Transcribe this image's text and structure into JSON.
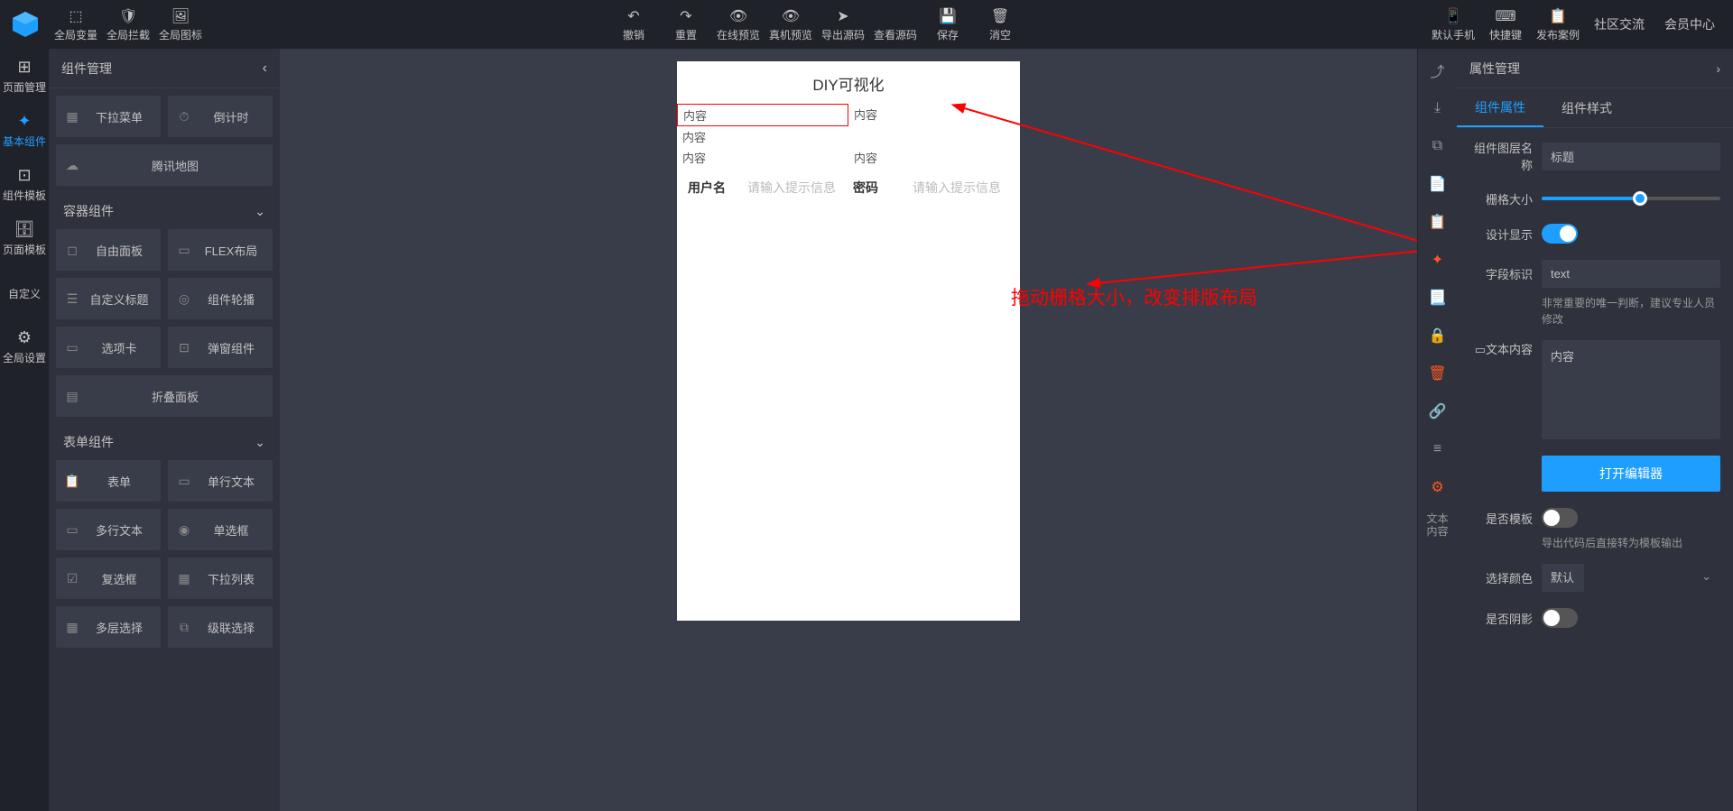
{
  "toolbar": {
    "left": [
      {
        "icon": "⬚",
        "label": "全局变量"
      },
      {
        "icon": "🛡",
        "label": "全局拦截"
      },
      {
        "icon": "🖼",
        "label": "全局图标"
      }
    ],
    "center": [
      {
        "icon": "↶",
        "label": "撤销"
      },
      {
        "icon": "↷",
        "label": "重置"
      },
      {
        "icon": "👁",
        "label": "在线预览"
      },
      {
        "icon": "👁",
        "label": "真机预览"
      },
      {
        "icon": "➤",
        "label": "导出源码"
      },
      {
        "icon": "</>",
        "label": "查看源码"
      },
      {
        "icon": "💾",
        "label": "保存"
      },
      {
        "icon": "🗑",
        "label": "消空"
      }
    ],
    "right": [
      {
        "icon": "📱",
        "label": "默认手机"
      },
      {
        "icon": "⌨",
        "label": "快捷键"
      },
      {
        "icon": "📋",
        "label": "发布案例"
      }
    ],
    "links": [
      "社区交流",
      "会员中心"
    ]
  },
  "left_nav": [
    {
      "icon": "⊞",
      "label": "页面管理",
      "active": false
    },
    {
      "icon": "✦",
      "label": "基本组件",
      "active": true
    },
    {
      "icon": "⊡",
      "label": "组件模板",
      "active": false
    },
    {
      "icon": "🗄",
      "label": "页面模板",
      "active": false
    },
    {
      "icon": "</>",
      "label": "自定义",
      "active": false
    },
    {
      "icon": "⚙",
      "label": "全局设置",
      "active": false
    }
  ],
  "comp_panel": {
    "title": "组件管理",
    "group0": [
      {
        "icon": "▦",
        "label": "下拉菜单"
      },
      {
        "icon": "⏱",
        "label": "倒计时"
      },
      {
        "icon": "☁",
        "label": "腾讯地图"
      }
    ],
    "group1_title": "容器组件",
    "group1": [
      {
        "icon": "◻",
        "label": "自由面板"
      },
      {
        "icon": "▭",
        "label": "FLEX布局"
      },
      {
        "icon": "☰",
        "label": "自定义标题"
      },
      {
        "icon": "◎",
        "label": "组件轮播"
      },
      {
        "icon": "▭",
        "label": "选项卡"
      },
      {
        "icon": "⊡",
        "label": "弹窗组件"
      },
      {
        "icon": "▤",
        "label": "折叠面板"
      }
    ],
    "group2_title": "表单组件",
    "group2": [
      {
        "icon": "📋",
        "label": "表单"
      },
      {
        "icon": "▭",
        "label": "单行文本"
      },
      {
        "icon": "▭",
        "label": "多行文本"
      },
      {
        "icon": "◉",
        "label": "单选框"
      },
      {
        "icon": "☑",
        "label": "复选框"
      },
      {
        "icon": "▦",
        "label": "下拉列表"
      },
      {
        "icon": "▦",
        "label": "多层选择"
      },
      {
        "icon": "⧉",
        "label": "级联选择"
      }
    ]
  },
  "phone": {
    "title": "DIY可视化",
    "cells": [
      "内容",
      "内容",
      "内容",
      "内容",
      "内容"
    ],
    "form": {
      "user_label": "用户名",
      "user_ph": "请输入提示信息",
      "pwd_label": "密码",
      "pwd_ph": "请输入提示信息"
    }
  },
  "annotation_text": "拖动栅格大小，改变排版布局",
  "right_tools": [
    {
      "t": "icon",
      "v": "⤴"
    },
    {
      "t": "icon",
      "v": "⤓"
    },
    {
      "t": "icon",
      "v": "⧉"
    },
    {
      "t": "icon",
      "v": "📄",
      "c": "#5fb878"
    },
    {
      "t": "icon",
      "v": "📋",
      "c": "#5fb878"
    },
    {
      "t": "icon",
      "v": "✦",
      "c": "#ff5722"
    },
    {
      "t": "icon",
      "v": "📃",
      "c": "#5fb878"
    },
    {
      "t": "icon",
      "v": "🔒"
    },
    {
      "t": "icon",
      "v": "🗑",
      "c": "#ff5722"
    },
    {
      "t": "icon",
      "v": "🔗"
    },
    {
      "t": "icon",
      "v": "≡"
    },
    {
      "t": "icon",
      "v": "⚙",
      "c": "#ff5722"
    },
    {
      "t": "text",
      "v": "文本\n内容"
    }
  ],
  "prop": {
    "panel_title": "属性管理",
    "tabs": [
      "组件属性",
      "组件样式"
    ],
    "layer_name_label": "组件图层名称",
    "layer_name_value": "标题",
    "grid_label": "栅格大小",
    "design_show_label": "设计显示",
    "design_show_on": true,
    "field_label": "字段标识",
    "field_value": "text",
    "field_help": "非常重要的唯一判断，建议专业人员修改",
    "content_label": "▭文本内容",
    "content_value": "内容",
    "editor_btn": "打开编辑器",
    "template_label": "是否模板",
    "template_on": false,
    "template_help": "导出代码后直接转为模板输出",
    "color_label": "选择颜色",
    "color_value": "默认",
    "shadow_label": "是否阴影",
    "shadow_on": false
  }
}
